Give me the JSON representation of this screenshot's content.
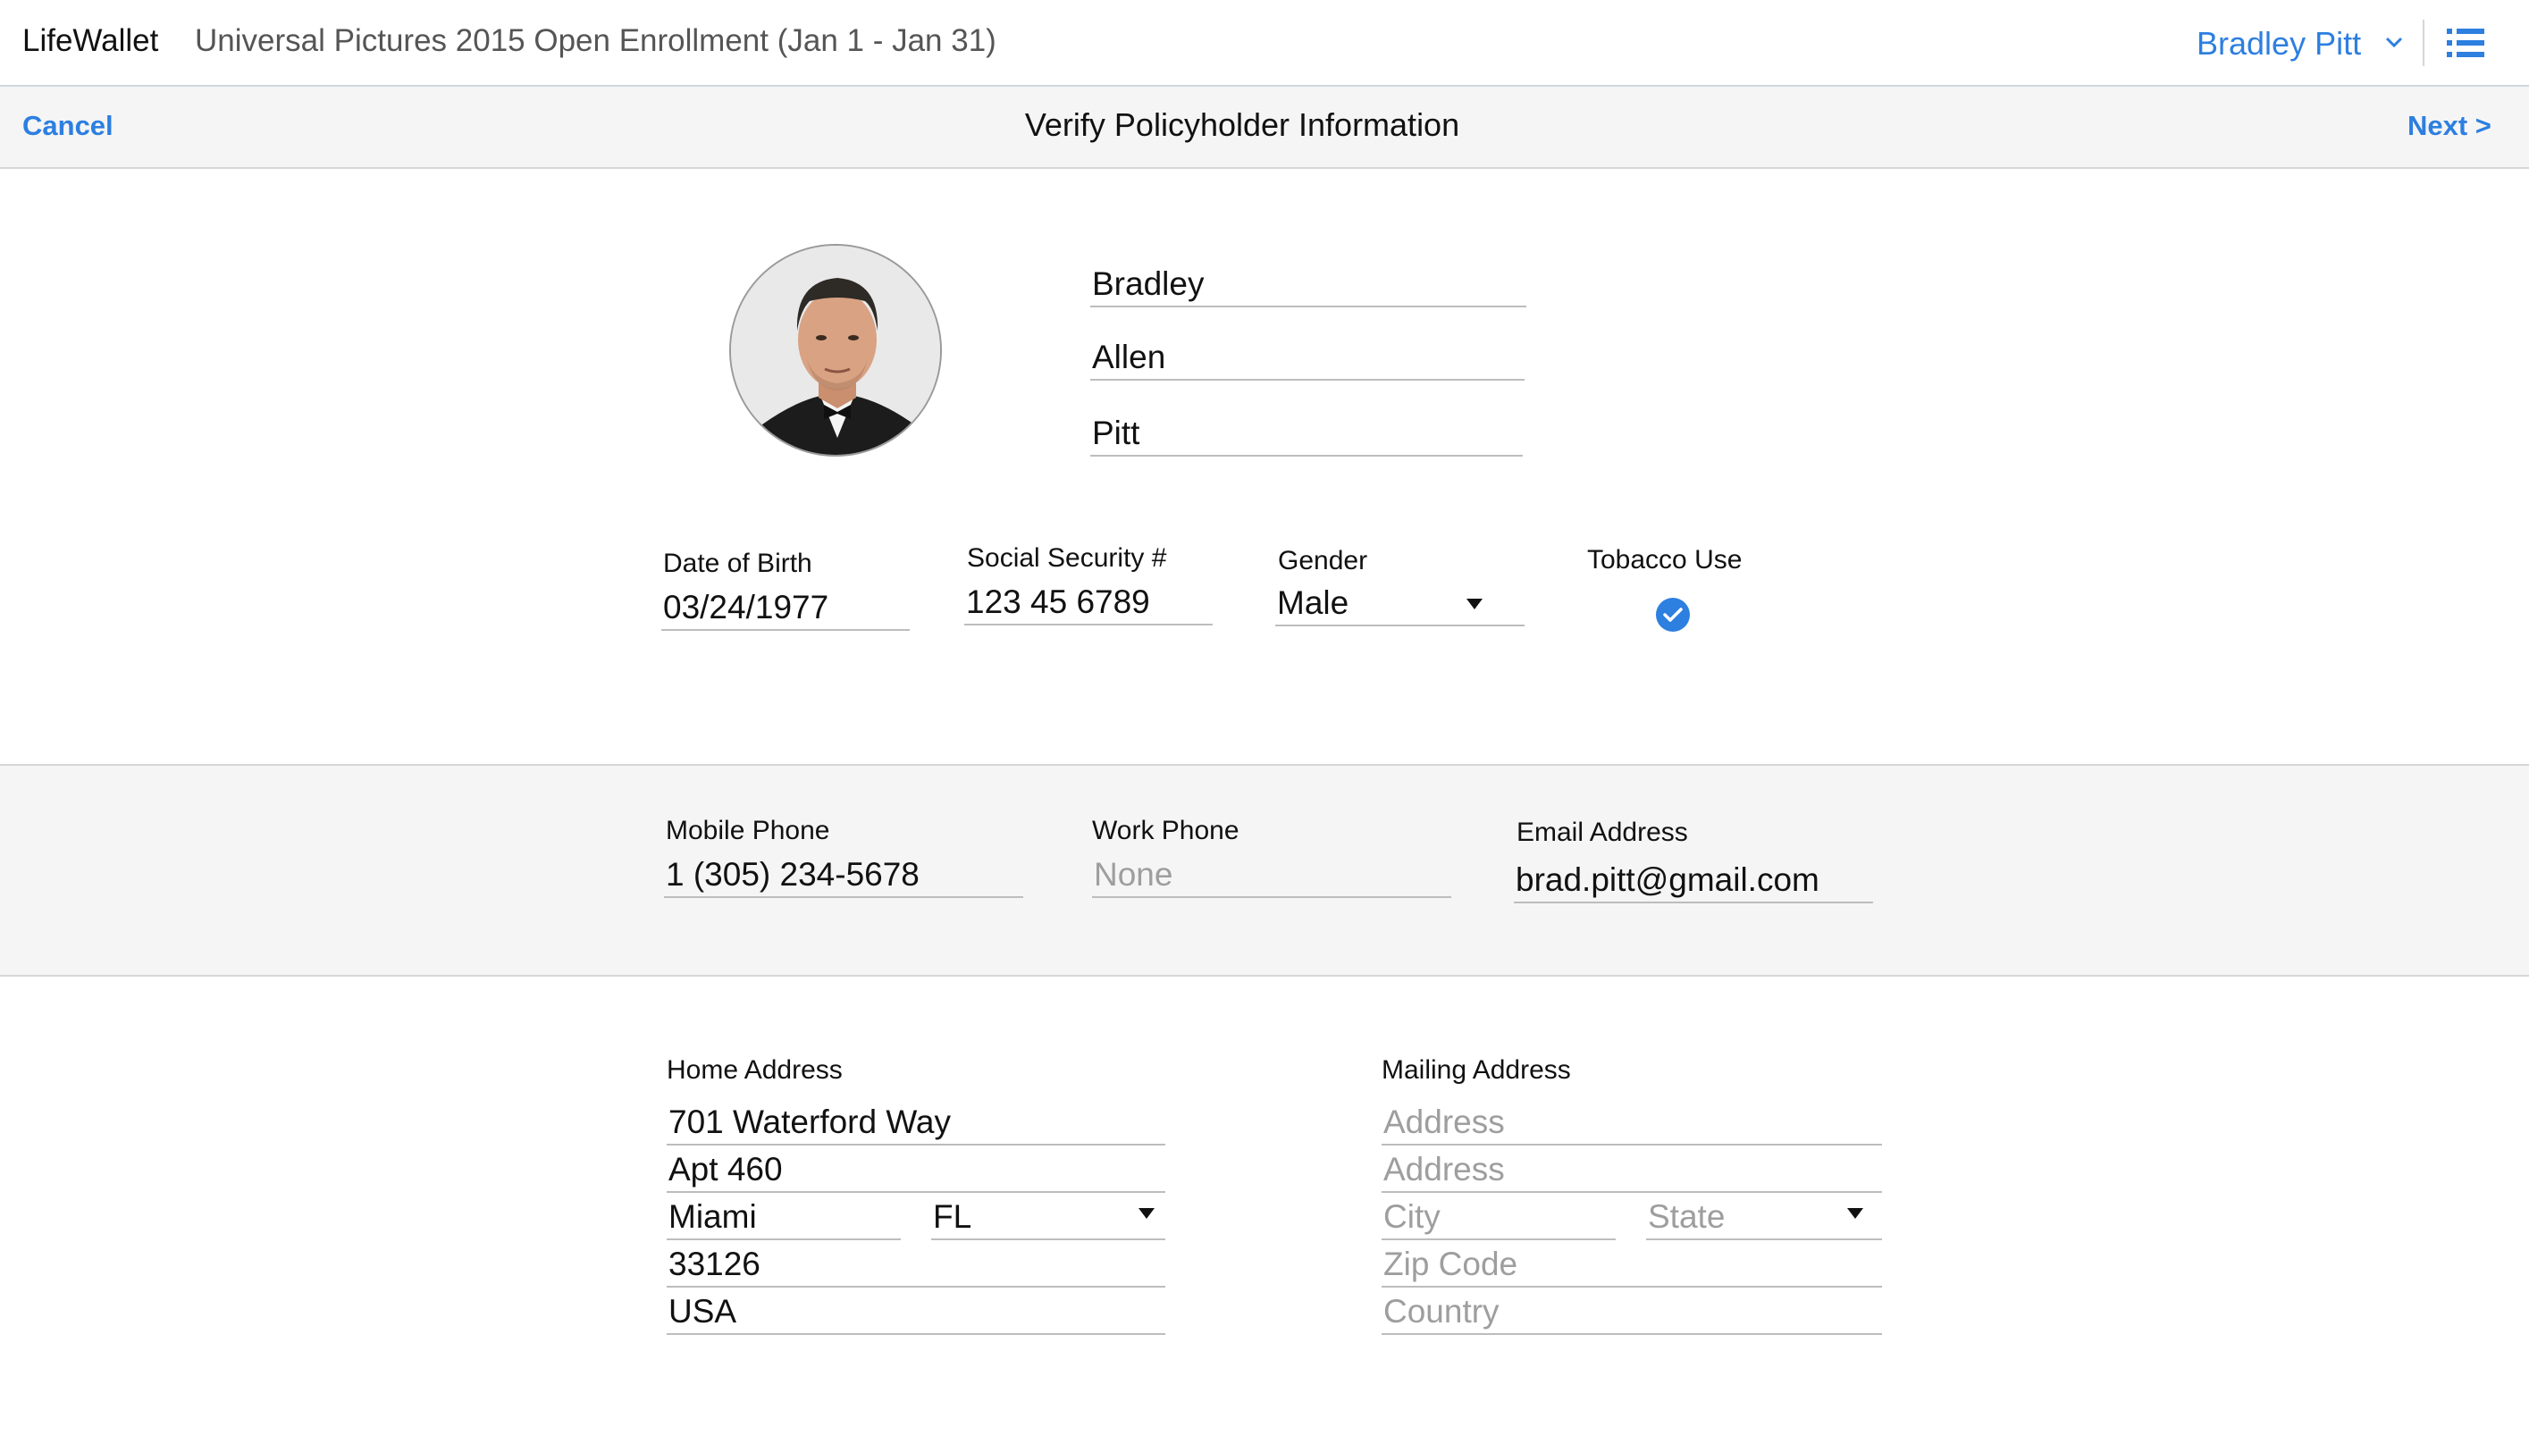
{
  "header": {
    "brand": "LifeWallet",
    "enrollment_title": "Universal Pictures 2015 Open Enrollment (Jan 1 - Jan 31)",
    "user_name": "Bradley Pitt"
  },
  "subbar": {
    "cancel_label": "Cancel",
    "title": "Verify Policyholder Information",
    "next_label": "Next >"
  },
  "name": {
    "first": "Bradley",
    "middle": "Allen",
    "last": "Pitt"
  },
  "details": {
    "dob_label": "Date of Birth",
    "dob_value": "03/24/1977",
    "ssn_label": "Social Security #",
    "ssn_value": "123  45  6789",
    "gender_label": "Gender",
    "gender_value": "Male",
    "tobacco_label": "Tobacco Use",
    "tobacco_checked": true
  },
  "contact": {
    "mobile_label": "Mobile Phone",
    "mobile_value": "1 (305) 234-5678",
    "work_label": "Work Phone",
    "work_placeholder": "None",
    "email_label": "Email Address",
    "email_value": "brad.pitt@gmail.com"
  },
  "home_address": {
    "label": "Home Address",
    "line1": "701 Waterford Way",
    "line2": "Apt 460",
    "city": "Miami",
    "state": "FL",
    "zip": "33126",
    "country": "USA"
  },
  "mailing_address": {
    "label": "Mailing Address",
    "line1_placeholder": "Address",
    "line2_placeholder": "Address",
    "city_placeholder": "City",
    "state_placeholder": "State",
    "zip_placeholder": "Zip Code",
    "country_placeholder": "Country"
  },
  "colors": {
    "accent": "#2d7fe0",
    "band": "#f5f5f5",
    "divider": "#d6d6d6"
  }
}
